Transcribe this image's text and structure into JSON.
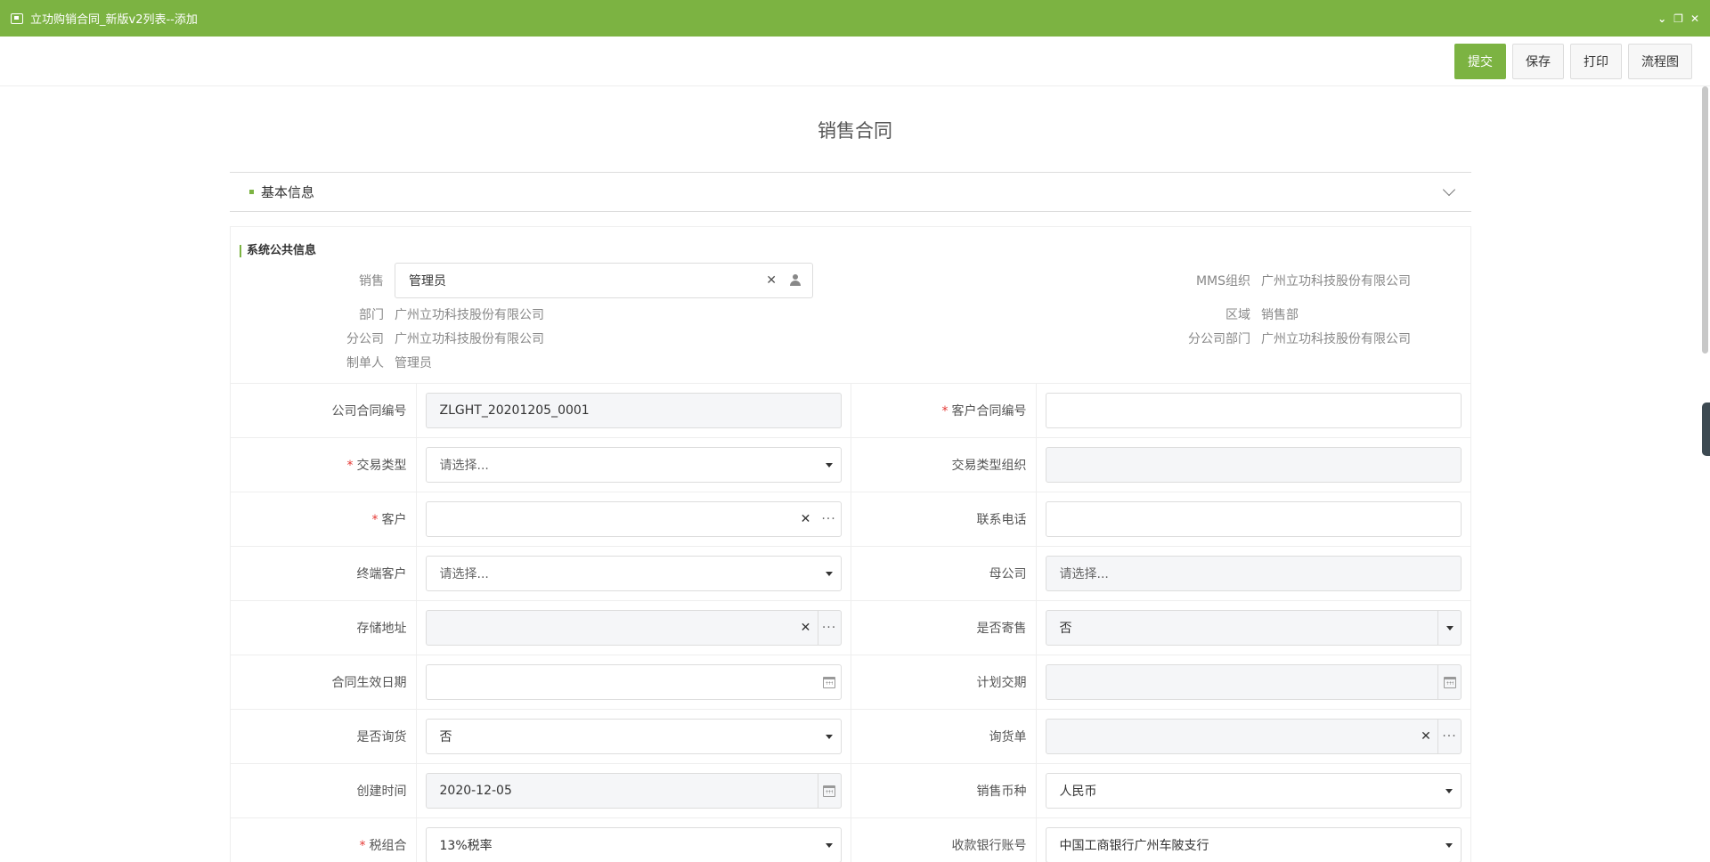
{
  "window": {
    "title": "立功购销合同_新版v2列表--添加",
    "controls": [
      "collapse",
      "restore",
      "close"
    ]
  },
  "toolbar": {
    "submit": "提交",
    "save": "保存",
    "print": "打印",
    "flowchart": "流程图"
  },
  "page_title": "销售合同",
  "section": {
    "title": "基本信息"
  },
  "public_info": {
    "title": "系统公共信息",
    "sales_label": "销售",
    "sales_value": "管理员",
    "mms_label": "MMS组织",
    "mms_value": "广州立功科技股份有限公司",
    "dept_label": "部门",
    "dept_value": "广州立功科技股份有限公司",
    "region_label": "区域",
    "region_value": "销售部",
    "branch_label": "分公司",
    "branch_value": "广州立功科技股份有限公司",
    "branch_dept_label": "分公司部门",
    "branch_dept_value": "广州立功科技股份有限公司",
    "creator_label": "制单人",
    "creator_value": "管理员"
  },
  "form": {
    "company_contract_no_label": "公司合同编号",
    "company_contract_no_value": "ZLGHT_20201205_0001",
    "customer_contract_no_label": "客户合同编号",
    "trade_type_label": "交易类型",
    "trade_type_placeholder": "请选择...",
    "trade_type_org_label": "交易类型组织",
    "customer_label": "客户",
    "phone_label": "联系电话",
    "end_customer_label": "终端客户",
    "end_customer_placeholder": "请选择...",
    "parent_company_label": "母公司",
    "parent_company_placeholder": "请选择...",
    "storage_label": "存储地址",
    "consign_label": "是否寄售",
    "consign_value": "否",
    "effective_date_label": "合同生效日期",
    "planned_delivery_label": "计划交期",
    "inquiry_label": "是否询货",
    "inquiry_value": "否",
    "inquiry_doc_label": "询货单",
    "created_time_label": "创建时间",
    "created_time_value": "2020-12-05",
    "currency_label": "销售币种",
    "currency_value": "人民币",
    "tax_label": "税组合",
    "tax_value": "13%税率",
    "bank_label": "收款银行账号",
    "bank_value": "中国工商银行广州车陂支行"
  }
}
